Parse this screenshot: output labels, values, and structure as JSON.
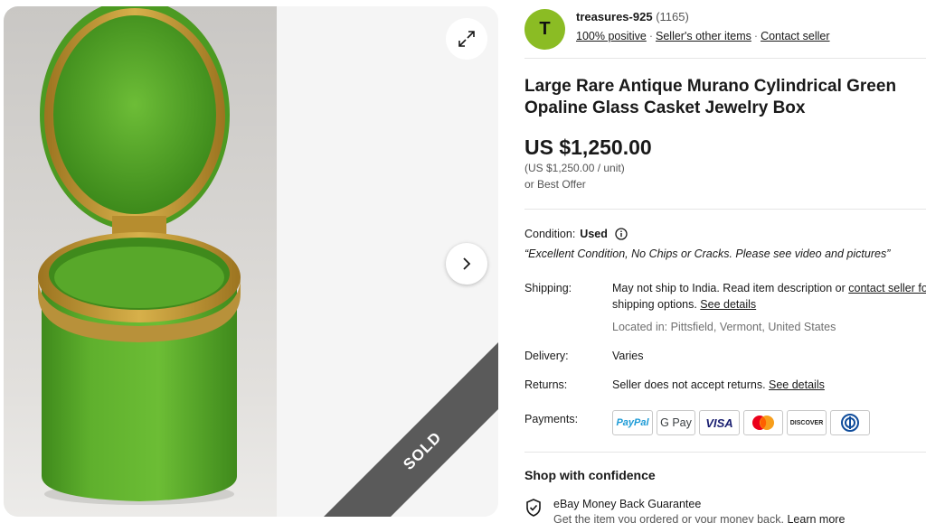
{
  "gallery": {
    "sold_label": "SOLD",
    "expand_icon": "expand-arrows-icon",
    "next_icon": "chevron-right-icon",
    "product_color": "#5aa82a"
  },
  "seller": {
    "avatar_initial": "T",
    "avatar_color": "#8bbc24",
    "name": "treasures-925",
    "feedback_count": "(1165)",
    "positive": "100% positive",
    "other_items": "Seller's other items",
    "contact": "Contact seller"
  },
  "listing": {
    "title": "Large Rare Antique Murano Cylindrical Green Opaline Glass Casket Jewelry Box",
    "price": "US $1,250.00",
    "unit_price": "(US $1,250.00 / unit)",
    "best_offer": "or Best Offer"
  },
  "condition": {
    "label": "Condition:",
    "value": "Used",
    "description": "“Excellent Condition, No Chips or Cracks. Please see video and pictures”"
  },
  "shipping": {
    "label": "Shipping:",
    "line1_text": "May not ship to India. Read item description or ",
    "line1_link": "contact seller for",
    "line2_text": "shipping options. ",
    "line2_link": "See details",
    "location": "Located in: Pittsfield, Vermont, United States"
  },
  "delivery": {
    "label": "Delivery:",
    "value": "Varies"
  },
  "returns": {
    "label": "Returns:",
    "value": "Seller does not accept returns. ",
    "link": "See details"
  },
  "payments": {
    "label": "Payments:",
    "methods": [
      "PayPal",
      "G Pay",
      "VISA",
      "Mastercard",
      "DISCOVER",
      "Diners Club"
    ]
  },
  "confidence": {
    "heading": "Shop with confidence",
    "guarantee_title": "eBay Money Back Guarantee",
    "guarantee_desc": "Get the item you ordered or your money back. ",
    "learn_more": "Learn more"
  }
}
